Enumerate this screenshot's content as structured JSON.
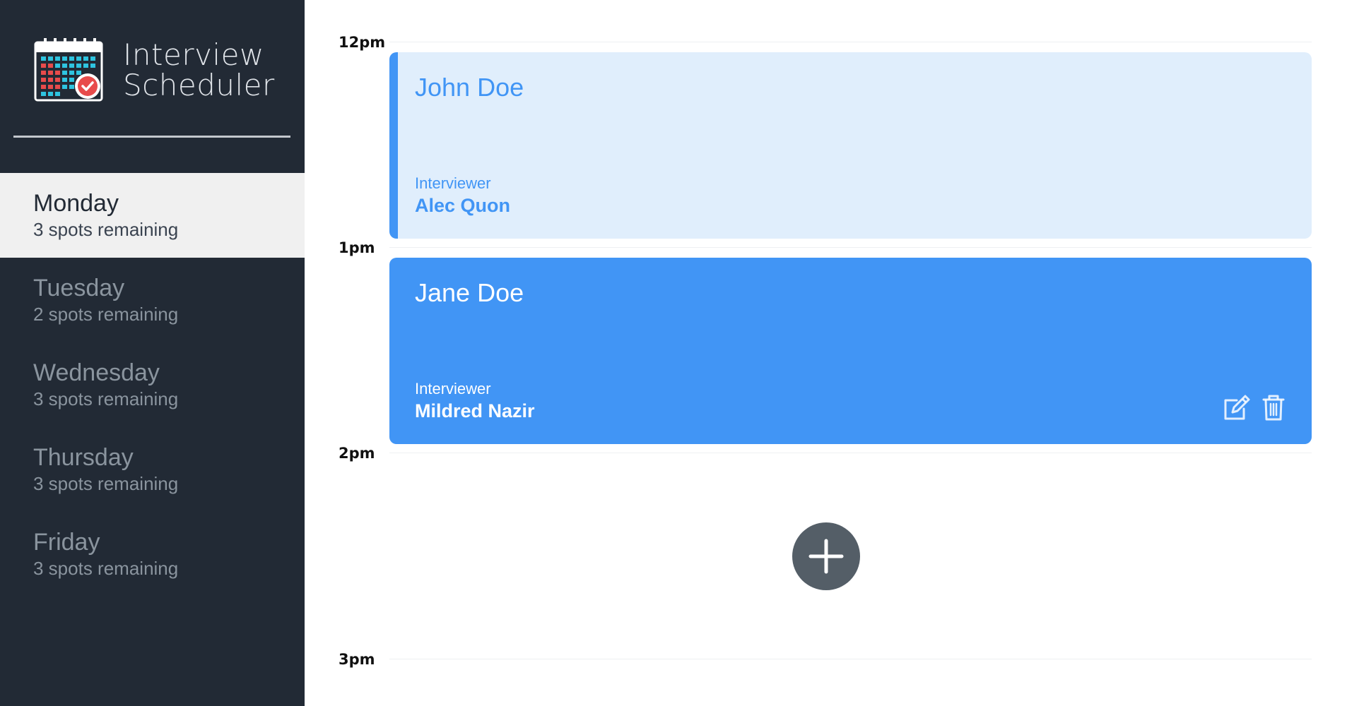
{
  "app": {
    "title_line1": "Interview",
    "title_line2": "Scheduler"
  },
  "sidebar": {
    "days": [
      {
        "name": "Monday",
        "spots": "3 spots remaining",
        "selected": true
      },
      {
        "name": "Tuesday",
        "spots": "2 spots remaining",
        "selected": false
      },
      {
        "name": "Wednesday",
        "spots": "3 spots remaining",
        "selected": false
      },
      {
        "name": "Thursday",
        "spots": "3 spots remaining",
        "selected": false
      },
      {
        "name": "Friday",
        "spots": "3 spots remaining",
        "selected": false
      }
    ]
  },
  "schedule": {
    "times": [
      "12pm",
      "1pm",
      "2pm",
      "3pm"
    ],
    "appointments": [
      {
        "student": "John Doe",
        "interviewer_label": "Interviewer",
        "interviewer": "Alec Quon",
        "style": "light"
      },
      {
        "student": "Jane Doe",
        "interviewer_label": "Interviewer",
        "interviewer": "Mildred Nazir",
        "style": "dark",
        "actions": [
          "edit-icon",
          "trash-icon"
        ]
      }
    ],
    "add_button_icon": "plus-icon"
  },
  "colors": {
    "sidebar_bg": "#222a35",
    "selected_bg": "#f0f0f0",
    "accent_blue": "#4195f5",
    "light_blue": "#e0eefc",
    "add_button": "#545e67"
  }
}
